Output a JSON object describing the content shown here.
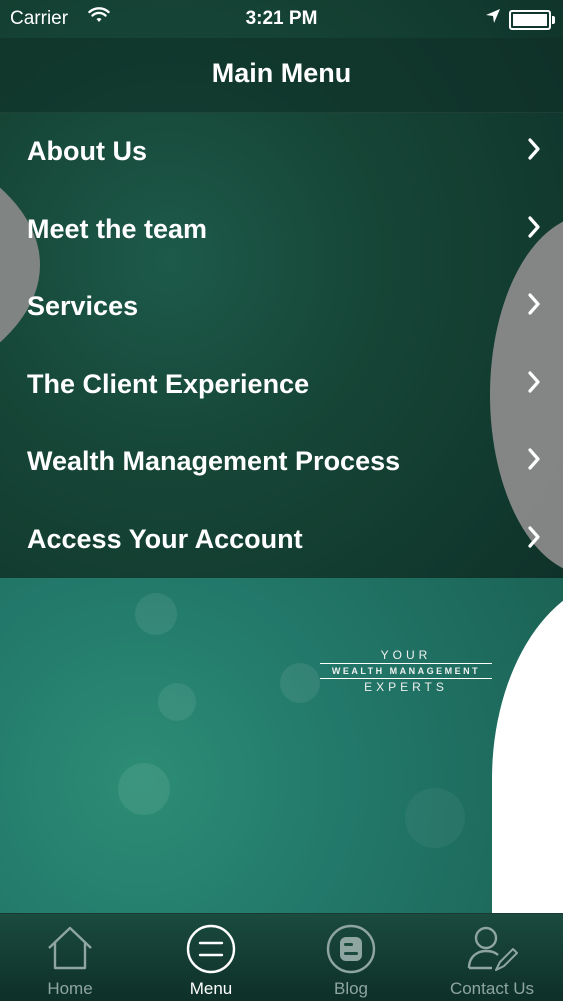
{
  "status_bar": {
    "carrier": "Carrier",
    "time": "3:21 PM",
    "battery_level": 1.0
  },
  "nav": {
    "title": "Main Menu"
  },
  "menu": {
    "items": [
      {
        "label": "About Us"
      },
      {
        "label": "Meet the team"
      },
      {
        "label": "Services"
      },
      {
        "label": "The Client Experience"
      },
      {
        "label": "Wealth Management Process"
      },
      {
        "label": "Access Your Account"
      }
    ]
  },
  "tagline": {
    "line1": "YOUR",
    "line2": "WEALTH MANAGEMENT",
    "line3": "EXPERTS"
  },
  "tabs": [
    {
      "label": "Home",
      "icon": "home-icon",
      "active": false
    },
    {
      "label": "Menu",
      "icon": "menu-icon",
      "active": true
    },
    {
      "label": "Blog",
      "icon": "blog-icon",
      "active": false
    },
    {
      "label": "Contact Us",
      "icon": "contact-icon",
      "active": false
    }
  ],
  "colors": {
    "top_bg": "#164637",
    "bottom_bg": "#22786a",
    "swoosh_grey": "#8a8a8a",
    "tab_inactive": "#8fa59f"
  }
}
